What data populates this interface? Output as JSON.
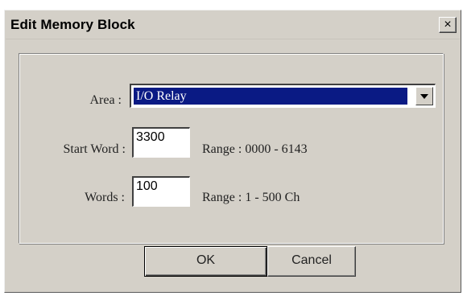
{
  "window": {
    "title": "Edit Memory Block",
    "close_glyph": "×"
  },
  "form": {
    "area": {
      "label": "Area :",
      "selected": "I/O Relay"
    },
    "start_word": {
      "label": "Start Word :",
      "value": "3300",
      "range": "Range : 0000 - 6143"
    },
    "words": {
      "label": "Words :",
      "value": "100",
      "range": "Range : 1 - 500 Ch"
    }
  },
  "buttons": {
    "ok": "OK",
    "cancel": "Cancel"
  },
  "colors": {
    "dialog_bg": "#d4d0c8",
    "selection": "#0a1a84"
  },
  "icons": {
    "close": "close-icon",
    "dropdown": "chevron-down-icon"
  }
}
